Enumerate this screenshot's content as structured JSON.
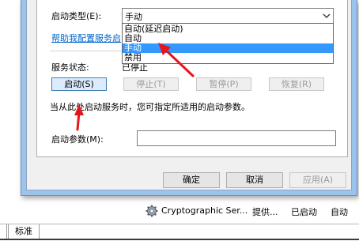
{
  "dialog": {
    "startup_type_label": "启动类型(E):",
    "startup_type_value": "手动",
    "dropdown_options": [
      "自动(延迟启动)",
      "自动",
      "手动",
      "禁用"
    ],
    "selected_option_index": 2,
    "help_link": "帮助我配置服务启",
    "service_status_label": "服务状态:",
    "service_status_value": "已停止",
    "buttons": {
      "start": "启动(S)",
      "stop": "停止(T)",
      "pause": "暂停(P)",
      "resume": "恢复(R)"
    },
    "hint_text": "当从此处启动服务时，您可指定所适用的启动参数。",
    "start_params_label": "启动参数(M):",
    "start_params_value": "",
    "footer": {
      "ok": "确定",
      "cancel": "取消",
      "apply": "应用(A)"
    }
  },
  "background": {
    "service_row": {
      "name": "Cryptographic Ser...",
      "description": "提供...",
      "status": "已启动",
      "startup": "自动"
    },
    "tab_label": "标准"
  },
  "colors": {
    "annotation_arrow": "#e8141c",
    "selection": "#3399ff",
    "link": "#0066cc"
  }
}
